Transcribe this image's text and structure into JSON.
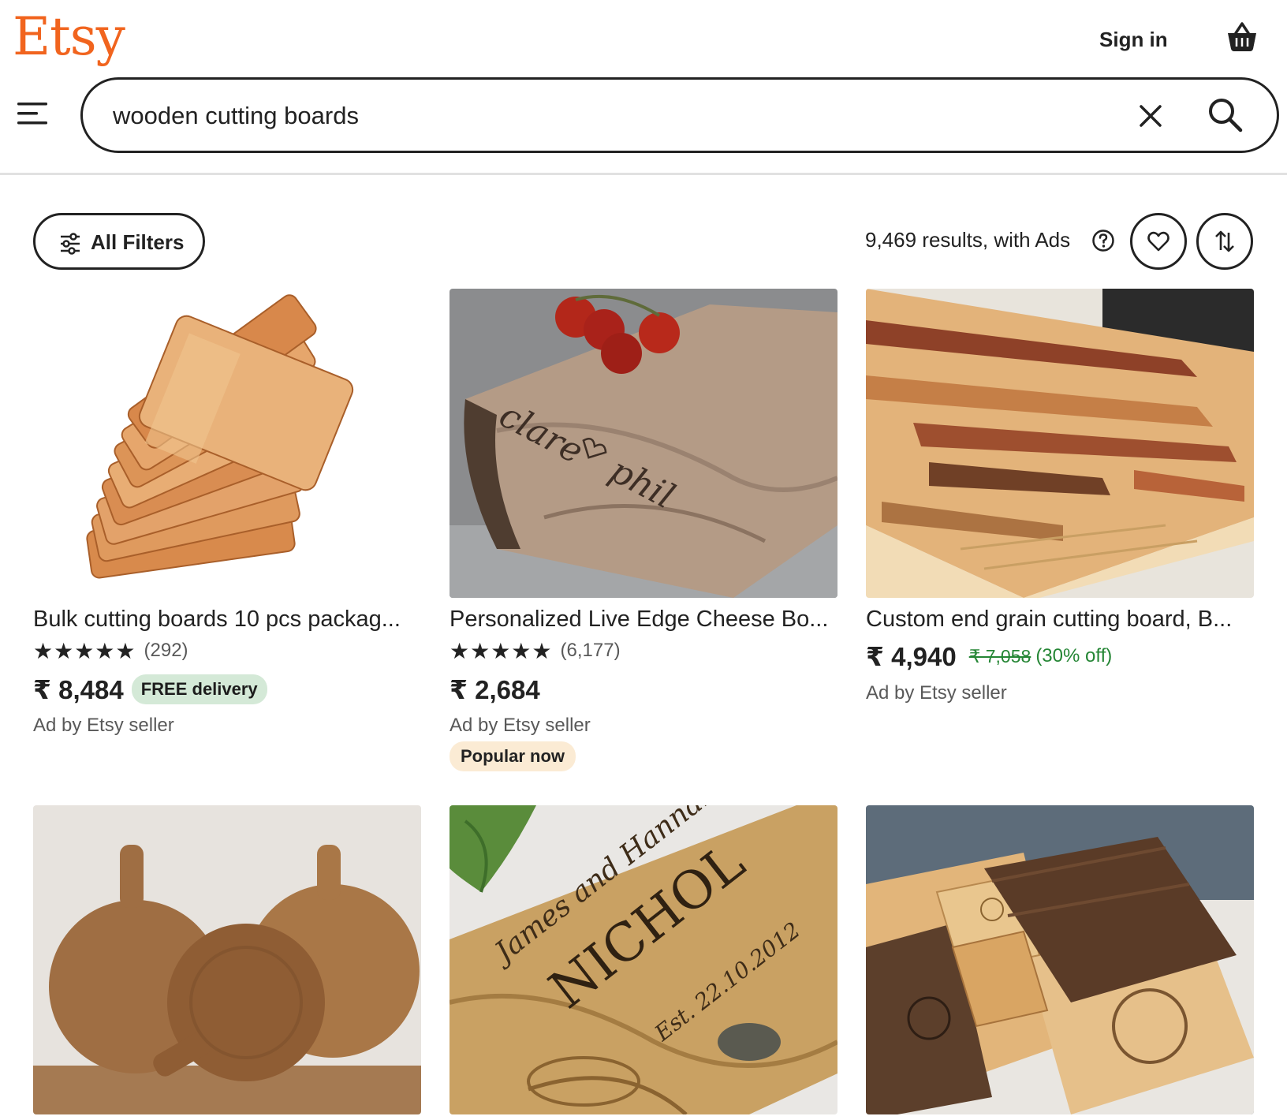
{
  "header": {
    "logo": "Etsy",
    "sign_in": "Sign in",
    "cart_icon": "shopping-basket-icon"
  },
  "search": {
    "query": "wooden cutting boards",
    "menu_icon": "hamburger-menu-icon",
    "clear_icon": "close-icon",
    "submit_icon": "search-icon"
  },
  "toolbar": {
    "filters_label": "All Filters",
    "results_text": "9,469 results, with Ads",
    "help_icon": "question-circle-icon",
    "save_icon": "heart-icon",
    "sort_icon": "sort-arrows-icon"
  },
  "colors": {
    "brand": "#f1641e",
    "discount": "#258635",
    "free_delivery_bg": "#d4e9d7",
    "popular_bg": "#fbebd4"
  },
  "listings": [
    {
      "title": "Bulk cutting boards 10 pcs packag...",
      "stars": "★★★★★",
      "reviews": "(292)",
      "price": "₹ 8,484",
      "badge": "FREE delivery",
      "ad_label": "Ad by Etsy seller"
    },
    {
      "title": "Personalized Live Edge Cheese Bo...",
      "stars": "★★★★★",
      "reviews": "(6,177)",
      "price": "₹ 2,684",
      "ad_label": "Ad by Etsy seller",
      "tag": "Popular now"
    },
    {
      "title": "Custom end grain cutting board, B...",
      "price": "₹ 4,940",
      "original_price": "₹ 7,058",
      "discount": "(30% off)",
      "ad_label": "Ad by Etsy seller"
    },
    {
      "image": "round-rustic-boards"
    },
    {
      "image": "engraved-nichol-board",
      "engraving": "James and Hannah NICHOL Est. 22.10.2012"
    },
    {
      "image": "assorted-engraved-boards"
    }
  ]
}
